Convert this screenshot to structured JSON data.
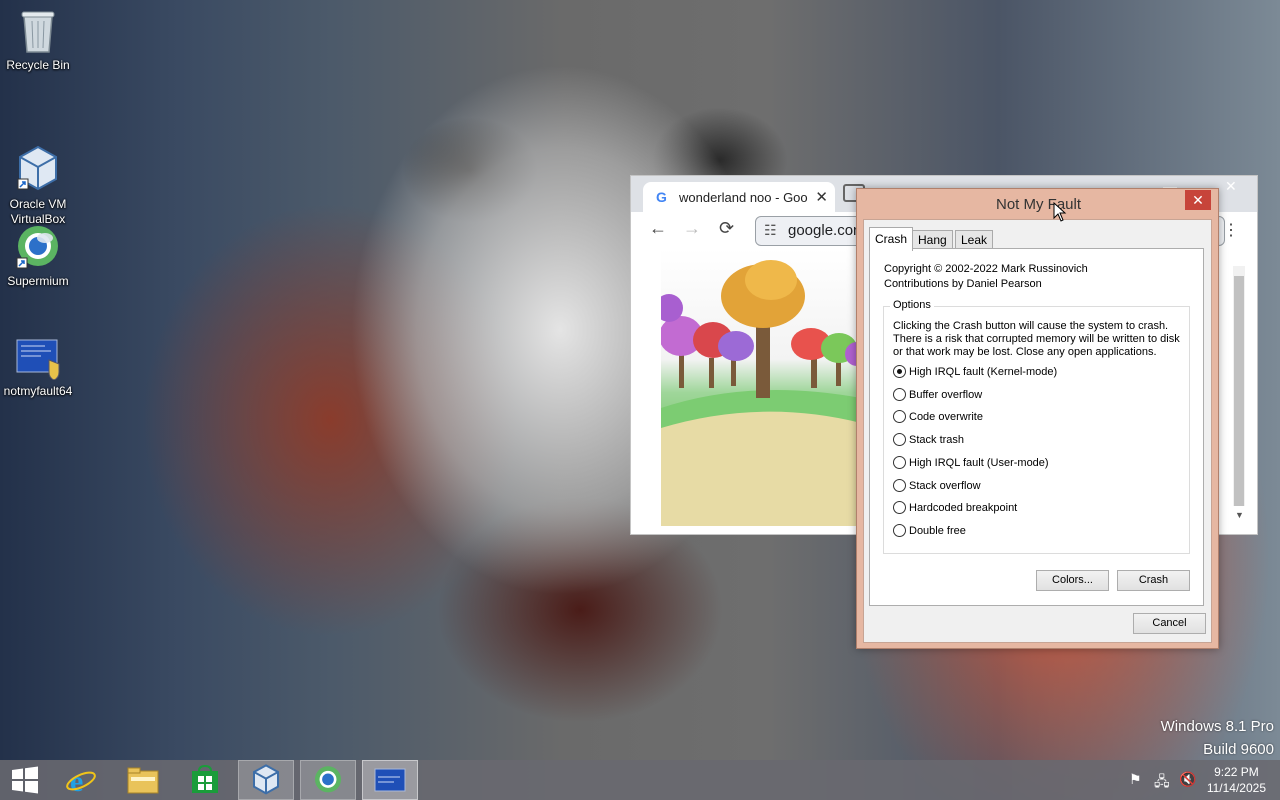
{
  "desktop": {
    "icons": [
      {
        "label": "Recycle Bin"
      },
      {
        "label": "Oracle VM\nVirtualBox"
      },
      {
        "label": "Supermium"
      },
      {
        "label": "notmyfault64"
      }
    ],
    "watermark": {
      "line1": "Windows 8.1 Pro",
      "line2": "Build 9600"
    }
  },
  "browser": {
    "tab_title": "wonderland noo - Goo",
    "tab_close": "✕",
    "address": "google.con",
    "nav": {
      "back": "←",
      "forward": "→",
      "reload": "⟳"
    },
    "menu": "⋮"
  },
  "dialog": {
    "title": "Not My Fault",
    "close": "✕",
    "tabs": [
      "Crash",
      "Hang",
      "Leak"
    ],
    "active_tab": "Crash",
    "copyright": "Copyright © 2002-2022 Mark Russinovich",
    "contributions": "Contributions by Daniel Pearson",
    "options_legend": "Options",
    "options_desc": "Clicking the Crash button will cause the system to crash. There is a risk that corrupted memory will be written to disk or that work may be lost. Close any open applications.",
    "options": [
      {
        "label": "High IRQL fault (Kernel-mode)",
        "selected": true
      },
      {
        "label": "Buffer overflow",
        "selected": false
      },
      {
        "label": "Code overwrite",
        "selected": false
      },
      {
        "label": "Stack trash",
        "selected": false
      },
      {
        "label": "High IRQL fault (User-mode)",
        "selected": false
      },
      {
        "label": "Stack overflow",
        "selected": false
      },
      {
        "label": "Hardcoded breakpoint",
        "selected": false
      },
      {
        "label": "Double free",
        "selected": false
      }
    ],
    "buttons": {
      "colors": "Colors...",
      "crash": "Crash",
      "cancel": "Cancel"
    }
  },
  "taskbar": {
    "apps": [
      "start",
      "internet-explorer",
      "file-explorer",
      "store",
      "virtualbox",
      "supermium",
      "notmyfault"
    ],
    "clock": {
      "time": "9:22 PM",
      "date": "11/14/2025"
    }
  },
  "colors": {
    "dialog_frame": "#e6b7a2",
    "close_button": "#c7443a",
    "taskbar": "#69696f"
  }
}
